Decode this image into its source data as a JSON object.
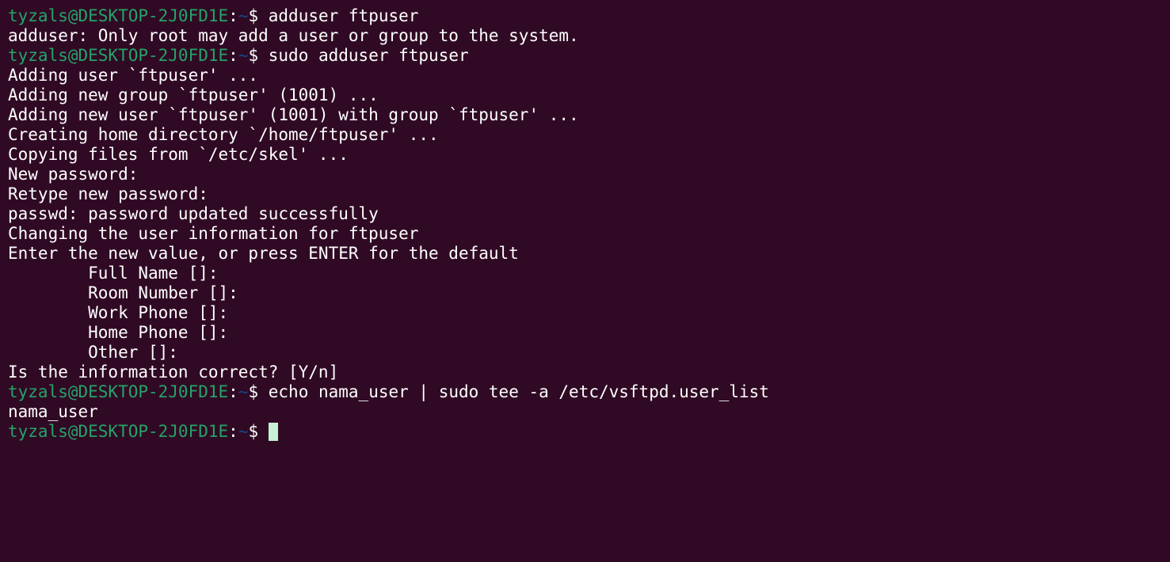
{
  "terminal": {
    "colors": {
      "background": "#300a24",
      "prompt_user": "#26a269",
      "prompt_path": "#12488b",
      "text": "#ffffff",
      "cursor": "#c6f2d6"
    },
    "prompt": {
      "user_host": "tyzals@DESKTOP-2J0FD1E",
      "colon": ":",
      "path": "~",
      "symbol": "$ "
    },
    "lines": [
      {
        "type": "prompt",
        "command": "adduser ftpuser"
      },
      {
        "type": "output",
        "text": "adduser: Only root may add a user or group to the system."
      },
      {
        "type": "prompt",
        "command": "sudo adduser ftpuser"
      },
      {
        "type": "output",
        "text": "Adding user `ftpuser' ..."
      },
      {
        "type": "output",
        "text": "Adding new group `ftpuser' (1001) ..."
      },
      {
        "type": "output",
        "text": "Adding new user `ftpuser' (1001) with group `ftpuser' ..."
      },
      {
        "type": "output",
        "text": "Creating home directory `/home/ftpuser' ..."
      },
      {
        "type": "output",
        "text": "Copying files from `/etc/skel' ..."
      },
      {
        "type": "output",
        "text": "New password:"
      },
      {
        "type": "output",
        "text": "Retype new password:"
      },
      {
        "type": "output",
        "text": "passwd: password updated successfully"
      },
      {
        "type": "output",
        "text": "Changing the user information for ftpuser"
      },
      {
        "type": "output",
        "text": "Enter the new value, or press ENTER for the default"
      },
      {
        "type": "output",
        "text": "        Full Name []:"
      },
      {
        "type": "output",
        "text": "        Room Number []:"
      },
      {
        "type": "output",
        "text": "        Work Phone []:"
      },
      {
        "type": "output",
        "text": "        Home Phone []:"
      },
      {
        "type": "output",
        "text": "        Other []:"
      },
      {
        "type": "output",
        "text": "Is the information correct? [Y/n]"
      },
      {
        "type": "prompt",
        "command": "echo nama_user | sudo tee -a /etc/vsftpd.user_list"
      },
      {
        "type": "output",
        "text": "nama_user"
      },
      {
        "type": "prompt",
        "command": "",
        "cursor": true
      }
    ]
  }
}
